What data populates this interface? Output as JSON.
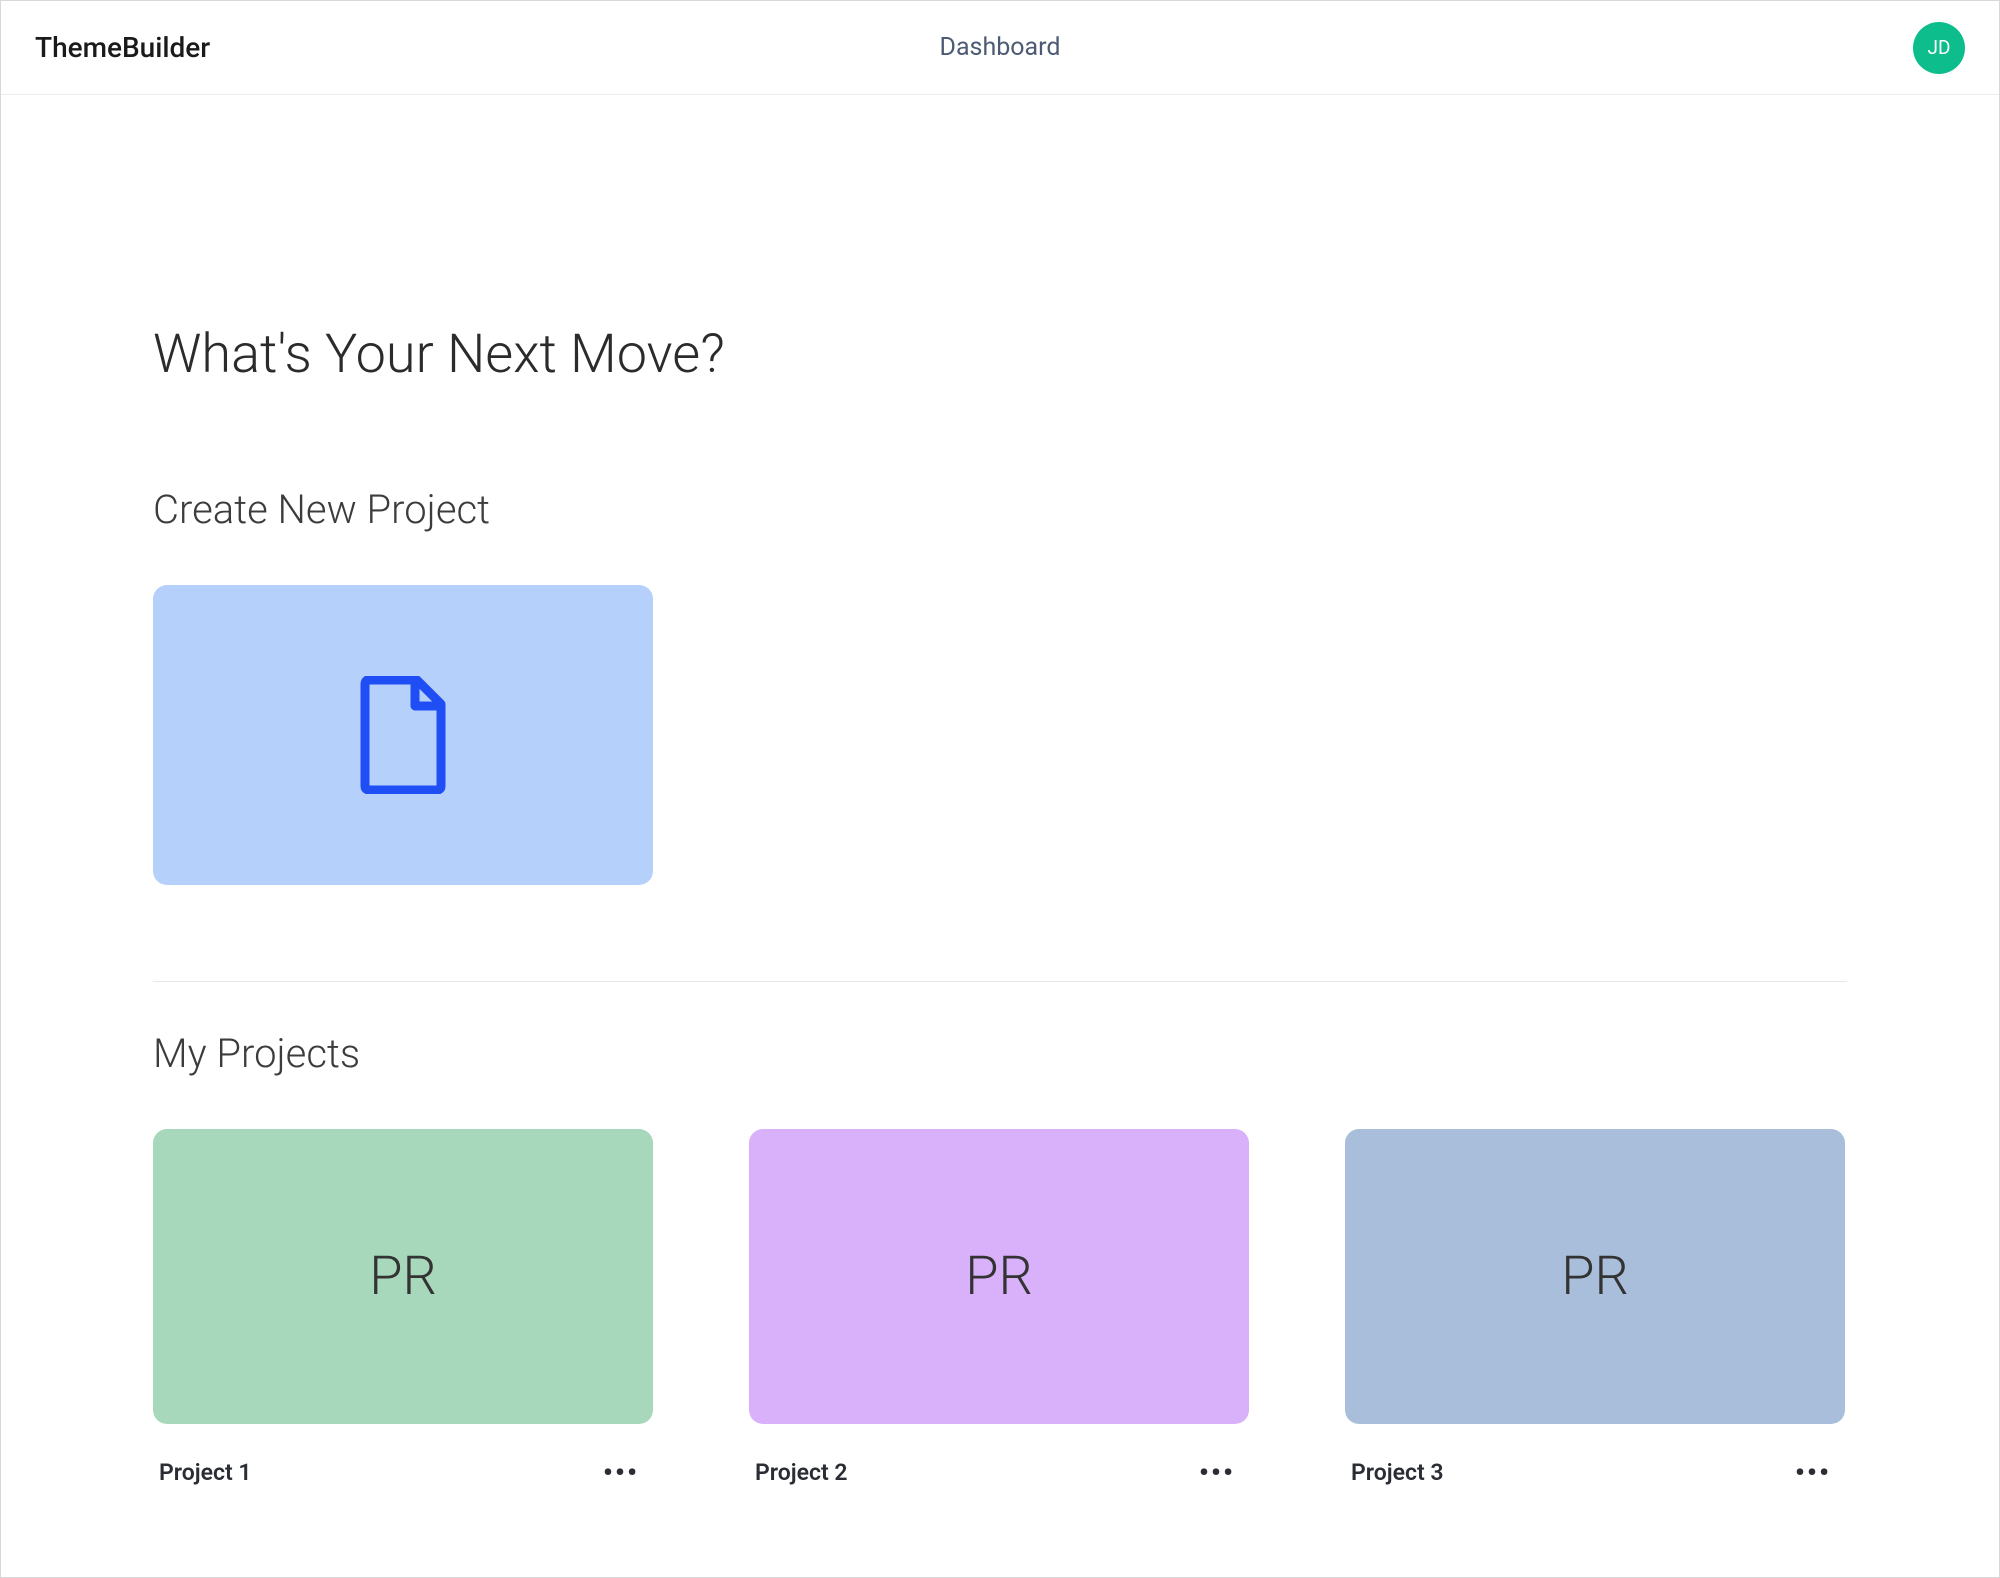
{
  "header": {
    "app_name": "ThemeBuilder",
    "page_label": "Dashboard",
    "avatar_initials": "JD"
  },
  "main": {
    "page_title": "What's Your Next Move?",
    "create_section_title": "Create New Project",
    "my_projects_title": "My Projects"
  },
  "projects": [
    {
      "card_label": "PR",
      "name": "Project 1",
      "bg_color": "#a7d8bb"
    },
    {
      "card_label": "PR",
      "name": "Project 2",
      "bg_color": "#d9b1fa"
    },
    {
      "card_label": "PR",
      "name": "Project 3",
      "bg_color": "#a9bedb"
    }
  ],
  "icons": {
    "file_icon_color": "#1f4ef5",
    "create_card_bg": "#b5d0fb"
  }
}
